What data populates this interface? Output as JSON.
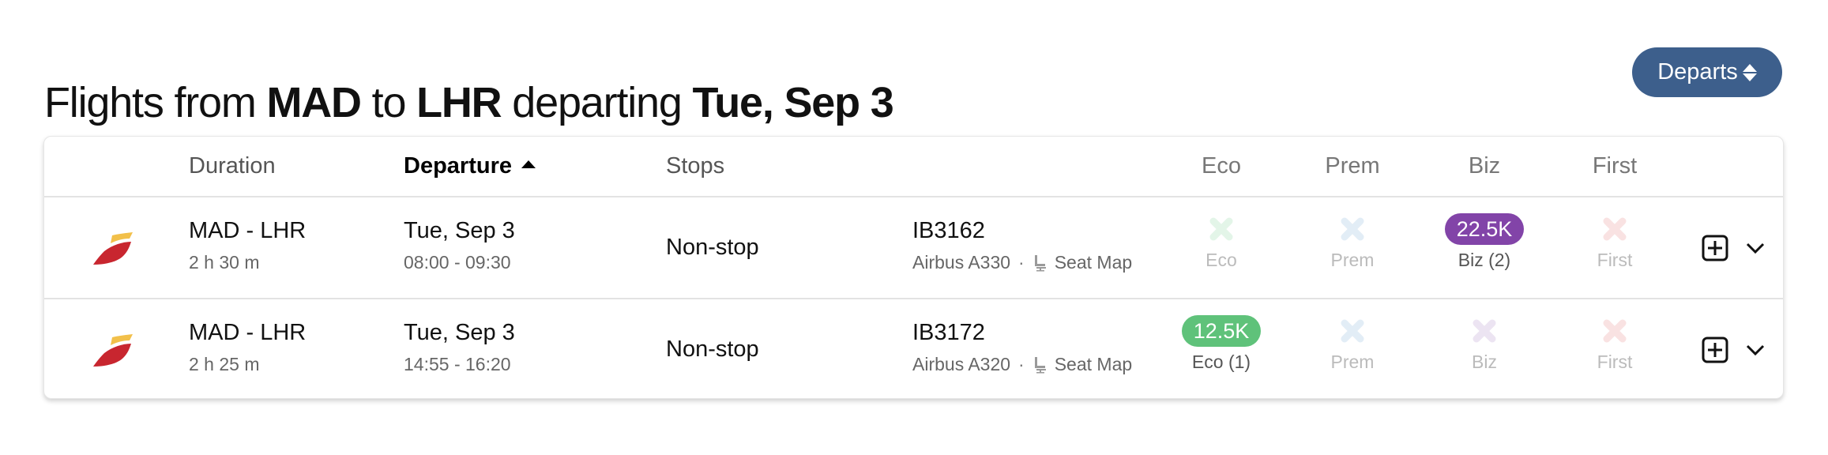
{
  "header": {
    "title_parts": [
      {
        "text": "Flights from ",
        "bold": false
      },
      {
        "text": "MAD",
        "bold": true
      },
      {
        "text": " to ",
        "bold": false
      },
      {
        "text": "LHR",
        "bold": true
      },
      {
        "text": " departing ",
        "bold": false
      },
      {
        "text": "Tue, Sep 3",
        "bold": true
      }
    ],
    "sort_button": {
      "label": "Departs",
      "icon": "sort-up-down-icon"
    }
  },
  "table": {
    "columns": {
      "duration": "Duration",
      "departure": "Departure",
      "stops": "Stops",
      "eco": "Eco",
      "prem": "Prem",
      "biz": "Biz",
      "first": "First"
    },
    "sorted_by": "departure",
    "sort_direction": "ascending",
    "rows": [
      {
        "airline_logo": "iberia-logo",
        "route": "MAD - LHR",
        "duration": "2 h 30 m",
        "date": "Tue, Sep 3",
        "times": "08:00 - 09:30",
        "stops": "Non-stop",
        "flight_number": "IB3162",
        "aircraft": "Airbus A330",
        "separator": "·",
        "seat_map_label": "Seat Map",
        "cabins": {
          "eco": {
            "available": false,
            "label": "Eco"
          },
          "prem": {
            "available": false,
            "label": "Prem"
          },
          "biz": {
            "available": true,
            "price": "22.5K",
            "label": "Biz (2)"
          },
          "first": {
            "available": false,
            "label": "First"
          }
        }
      },
      {
        "airline_logo": "iberia-logo",
        "route": "MAD - LHR",
        "duration": "2 h 25 m",
        "date": "Tue, Sep 3",
        "times": "14:55 - 16:20",
        "stops": "Non-stop",
        "flight_number": "IB3172",
        "aircraft": "Airbus A320",
        "separator": "·",
        "seat_map_label": "Seat Map",
        "cabins": {
          "eco": {
            "available": true,
            "price": "12.5K",
            "label": "Eco (1)"
          },
          "prem": {
            "available": false,
            "label": "Prem"
          },
          "biz": {
            "available": false,
            "label": "Biz"
          },
          "first": {
            "available": false,
            "label": "First"
          }
        }
      }
    ]
  },
  "colors": {
    "sort_button_bg": "#3d5f8c",
    "eco": "#5fc27a",
    "eco_unavailable": "#e3f5e8",
    "prem_unavailable": "#e2edf6",
    "biz": "#8244a8",
    "biz_unavailable": "#ece4f2",
    "first_unavailable": "#f9e2e2",
    "logo_red": "#c8262f",
    "logo_yellow": "#f2c04a"
  }
}
